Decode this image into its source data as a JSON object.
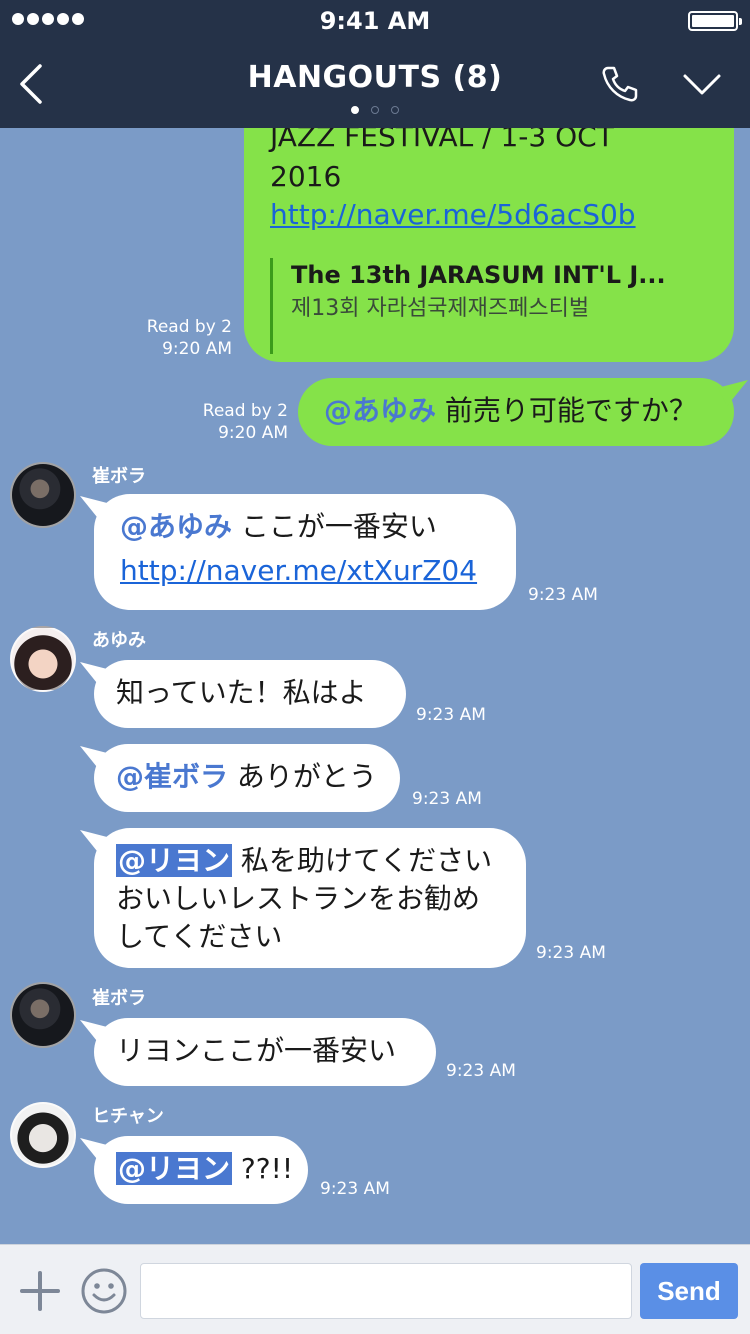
{
  "status_bar": {
    "time": "9:41 AM"
  },
  "header": {
    "title": "HANGOUTS (8)"
  },
  "messages": {
    "m1": {
      "text_top": "JAZZ FESTIVAL / 1-3 OCT",
      "text_year": "2016",
      "link": "http://naver.me/5d6acS0b",
      "preview_title": "The 13th JARASUM INT'L J...",
      "preview_desc": "제13회 자라섬국제재즈페스티벌",
      "read": "Read by 2",
      "time": "9:20 AM"
    },
    "m2": {
      "mention": "@あゆみ",
      "text": " 前売り可能ですか？",
      "read": "Read by 2",
      "time": "9:20 AM"
    },
    "m3": {
      "sender": "崔ボラ",
      "mention": "@あゆみ",
      "text": " ここが一番安い",
      "link": "http://naver.me/xtXurZ04",
      "time": "9:23 AM"
    },
    "m4": {
      "sender": "あゆみ",
      "text": "知っていた！私はよ",
      "time": "9:23 AM"
    },
    "m5": {
      "mention": "@崔ボラ",
      "text": " ありがとう",
      "time": "9:23 AM"
    },
    "m6": {
      "mention": "@リヨン",
      "line1": " 私を助けてください",
      "line2": "おいしいレストランをお勧め",
      "line3": "してください",
      "time": "9:23 AM"
    },
    "m7": {
      "sender": "崔ボラ",
      "text": "リヨンここが一番安い",
      "time": "9:23 AM"
    },
    "m8": {
      "sender": "ヒチャン",
      "mention": "@リヨン",
      "text": " ??!!",
      "time": "9:23 AM"
    }
  },
  "input": {
    "placeholder": "",
    "send_label": "Send"
  }
}
